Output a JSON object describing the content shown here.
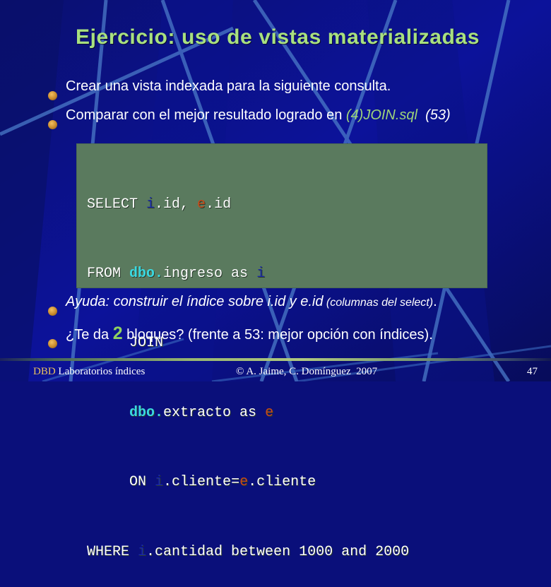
{
  "slide": {
    "title": "Ejercicio: uso de vistas materializadas",
    "bullets": [
      {
        "text": "Crear una vista indexada para la siguiente consulta."
      },
      {
        "prefix": "Comparar con el mejor resultado logrado en ",
        "file": "(4)JOIN.sql",
        "suffix": "  (53)"
      },
      {
        "main": "Ayuda: construir el índice sobre i.id y e.id",
        "note": " (columnas del select)",
        "end": "."
      },
      {
        "prefix": "¿Te da ",
        "number": "2",
        "suffix": " bloques? (frente a 53: mejor opción con índices)."
      }
    ],
    "code": {
      "line1": {
        "kw": "SELECT ",
        "a": "i",
        "b": ".id, ",
        "c": "e",
        "d": ".id"
      },
      "line2": {
        "kw": "FROM ",
        "dbo": "dbo.",
        "rest": "ingreso as ",
        "alias": "i"
      },
      "line3": {
        "indent": "     ",
        "kw": "JOIN"
      },
      "line4": {
        "indent": "     ",
        "dbo": "dbo.",
        "rest": "extracto as ",
        "alias": "e"
      },
      "line5": {
        "indent": "     ",
        "kw": "ON ",
        "a": "i",
        "b": ".cliente=",
        "c": "e",
        "d": ".cliente"
      },
      "line6": {
        "kw": "WHERE ",
        "a": "i",
        "rest": ".cantidad between 1000 and 2000"
      }
    }
  },
  "footer": {
    "course": "DBD",
    "section": "Laboratorios índices",
    "authors": "© A. Jaime, C. Domínguez  2007",
    "page_number": "47"
  },
  "colors": {
    "background": "#0a0f7a",
    "title": "#a8e080",
    "code_box": "#5a7a5e",
    "alias_i": "#1a2aa8",
    "alias_e": "#c84a18",
    "schema_dbo": "#3ad8e0",
    "highlight_green": "#9ed47a"
  }
}
